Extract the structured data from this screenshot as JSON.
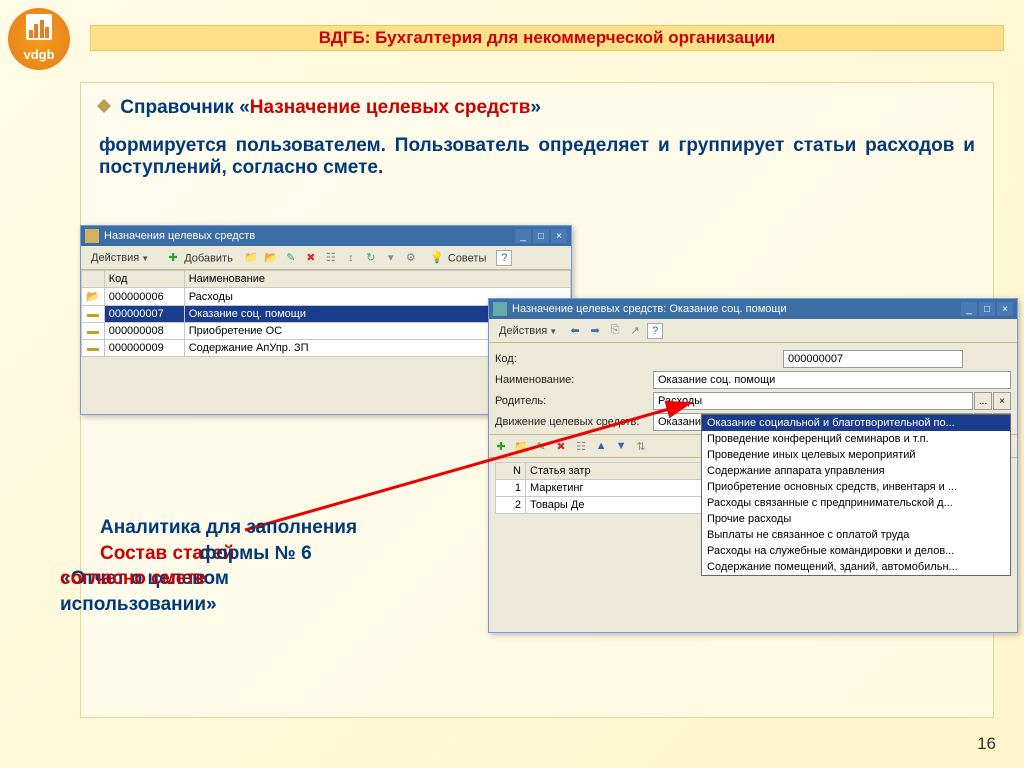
{
  "header": {
    "title": "ВДГБ: Бухгалтерия для некоммерческой организации"
  },
  "logo": "vdgb",
  "subheading": {
    "prefix": "Справочник «",
    "highlight": "Назначение целевых средств",
    "suffix": "»"
  },
  "body": "формируется пользователем. Пользователь определяет и группирует статьи расходов и поступлений, согласно смете.",
  "win1": {
    "title": "Назначения целевых средств",
    "toolbar": {
      "actions": "Действия",
      "add": "Добавить",
      "tips": "Советы"
    },
    "columns": {
      "code": "Код",
      "name": "Наименование"
    },
    "rows": [
      {
        "kind": "folder",
        "code": "000000006",
        "name": "Расходы",
        "sel": false
      },
      {
        "kind": "item",
        "code": "000000007",
        "name": "Оказание соц. помощи",
        "sel": true
      },
      {
        "kind": "item",
        "code": "000000008",
        "name": "Приобретение ОС",
        "sel": false
      },
      {
        "kind": "item",
        "code": "000000009",
        "name": "Содержание АпУпр. ЗП",
        "sel": false
      }
    ]
  },
  "win2": {
    "title": "Назначение целевых средств: Оказание соц. помощи",
    "toolbar": {
      "actions": "Действия"
    },
    "fields": {
      "code_label": "Код:",
      "code_value": "000000007",
      "name_label": "Наименование:",
      "name_value": "Оказание соц. помощи",
      "parent_label": "Родитель:",
      "parent_value": "Расходы",
      "movement_label": "Движение целевых средств:",
      "movement_value": "Оказание социальной и благотворительной по"
    },
    "subgrid": {
      "columns": {
        "n": "N",
        "article": "Статья затр"
      },
      "rows": [
        {
          "n": "1",
          "article": "Маркетинг"
        },
        {
          "n": "2",
          "article": "Товары Де"
        }
      ]
    },
    "dropdown": [
      "Оказание социальной и благотворительной по...",
      "Проведение конференций семинаров и т.п.",
      "Проведение иных целевых мероприятий",
      "Содержание аппарата управления",
      "Приобретение основных средств, инвентаря и ...",
      "Расходы связанные с предпринимательской д...",
      "Прочие расходы",
      "Выплаты не связанное с оплатой труда",
      "Расходы на служебные командировки и делов...",
      "Содержание помещений, зданий, автомобильн..."
    ]
  },
  "bottom": {
    "line1": "Аналитика для заполнения",
    "line2a": "Состав статей",
    "line2b": "формы № 6",
    "line3a": "«Отчет о целевом использовании»",
    "line3b": "согласно смете"
  },
  "page": "16"
}
